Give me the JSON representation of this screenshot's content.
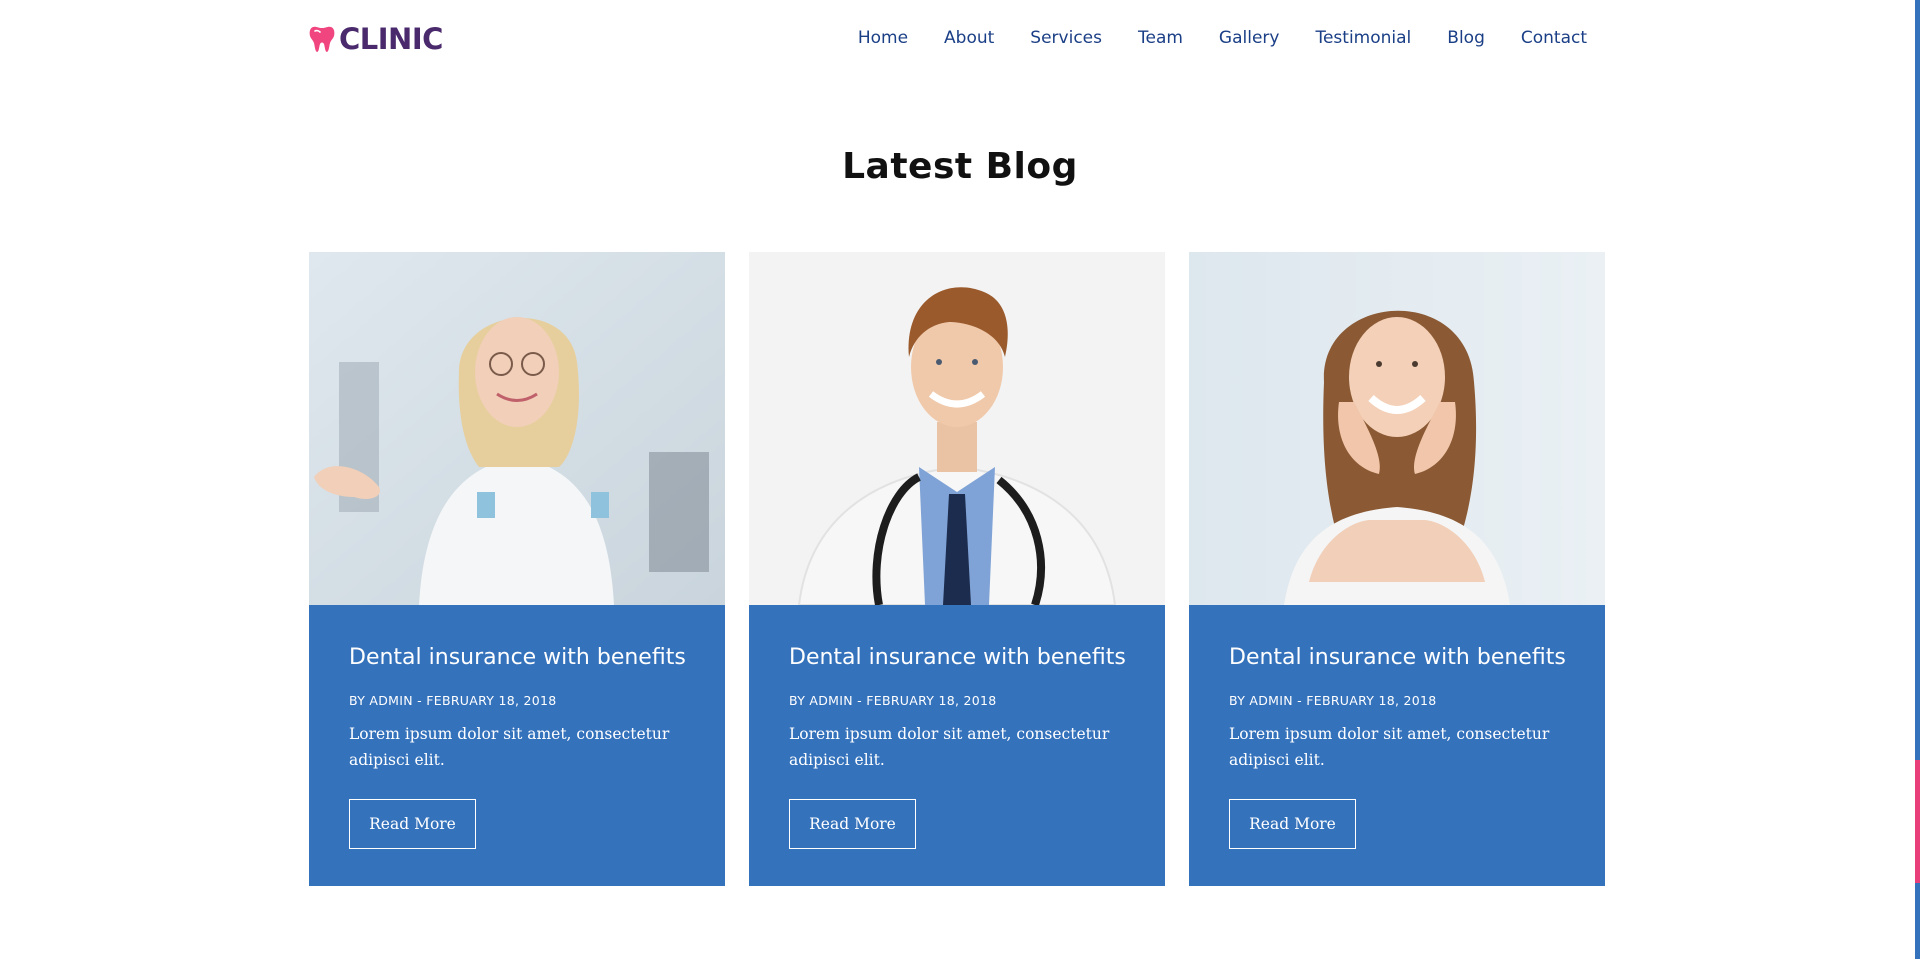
{
  "brand": {
    "name": "CLINIC",
    "tooth_color": "#f0457e",
    "text_color": "#4a2a6c"
  },
  "nav": {
    "items": [
      {
        "label": "Home"
      },
      {
        "label": "About"
      },
      {
        "label": "Services"
      },
      {
        "label": "Team"
      },
      {
        "label": "Gallery"
      },
      {
        "label": "Testimonial"
      },
      {
        "label": "Blog"
      },
      {
        "label": "Contact"
      }
    ]
  },
  "section": {
    "title": "Latest Blog"
  },
  "posts": [
    {
      "image_subject": "female-dentist-photo",
      "title": "Dental insurance with benefits",
      "meta": "BY ADMIN - FEBRUARY 18, 2018",
      "excerpt": "Lorem ipsum dolor sit amet, consectetur adipisci elit.",
      "button": "Read More"
    },
    {
      "image_subject": "male-doctor-photo",
      "title": "Dental insurance with benefits",
      "meta": "BY ADMIN - FEBRUARY 18, 2018",
      "excerpt": "Lorem ipsum dolor sit amet, consectetur adipisci elit.",
      "button": "Read More"
    },
    {
      "image_subject": "smiling-woman-photo",
      "title": "Dental insurance with benefits",
      "meta": "BY ADMIN - FEBRUARY 18, 2018",
      "excerpt": "Lorem ipsum dolor sit amet, consectetur adipisci elit.",
      "button": "Read More"
    }
  ],
  "colors": {
    "card_blue": "#3572bc",
    "nav_text": "#1b3f86",
    "scroll_accent": "#e83e79"
  }
}
